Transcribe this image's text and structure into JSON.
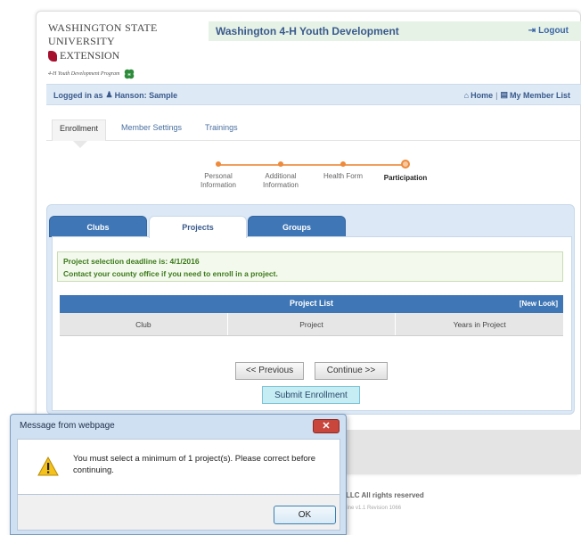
{
  "header": {
    "org_line1": "WASHINGTON STATE UNIVERSITY",
    "org_line2": "EXTENSION",
    "program": "4-H Youth Development Program",
    "title": "Washington 4-H Youth Development",
    "logout": "Logout"
  },
  "userbar": {
    "logged_in_as": "Logged in as",
    "user": "Hanson: Sample",
    "home": "Home",
    "separator": "|",
    "member_list": "My Member List"
  },
  "nav": {
    "tabs": [
      {
        "label": "Enrollment",
        "active": true
      },
      {
        "label": "Member Settings",
        "active": false
      },
      {
        "label": "Trainings",
        "active": false
      }
    ]
  },
  "steps": [
    {
      "line1": "Personal",
      "line2": "Information"
    },
    {
      "line1": "Additional",
      "line2": "Information"
    },
    {
      "line1": "Health Form",
      "line2": ""
    },
    {
      "line1": "Participation",
      "line2": "",
      "current": true
    }
  ],
  "panel": {
    "tabs": [
      {
        "label": "Clubs",
        "active": false
      },
      {
        "label": "Projects",
        "active": true
      },
      {
        "label": "Groups",
        "active": false
      }
    ],
    "alert_line1": "Project selection deadline is: 4/1/2016",
    "alert_line2": "Contact your county office if you need to enroll in a project.",
    "project_list": {
      "title": "Project List",
      "new_look": "[New Look]",
      "columns": [
        "Club",
        "Project",
        "Years in Project"
      ]
    },
    "previous_button": "<< Previous",
    "continue_button": "Continue >>",
    "submit_button": "Submit Enrollment"
  },
  "footer": {
    "rights": "LLC All rights reserved",
    "version": "line v1.1 Revision 1066"
  },
  "dialog": {
    "title": "Message from webpage",
    "close": "✕",
    "message": "You must select a minimum of 1 project(s). Please correct before continuing.",
    "ok": "OK"
  },
  "colors": {
    "accent_blue": "#3f76b5",
    "step_orange": "#ee8a3a",
    "alert_green": "#3a7a18"
  }
}
